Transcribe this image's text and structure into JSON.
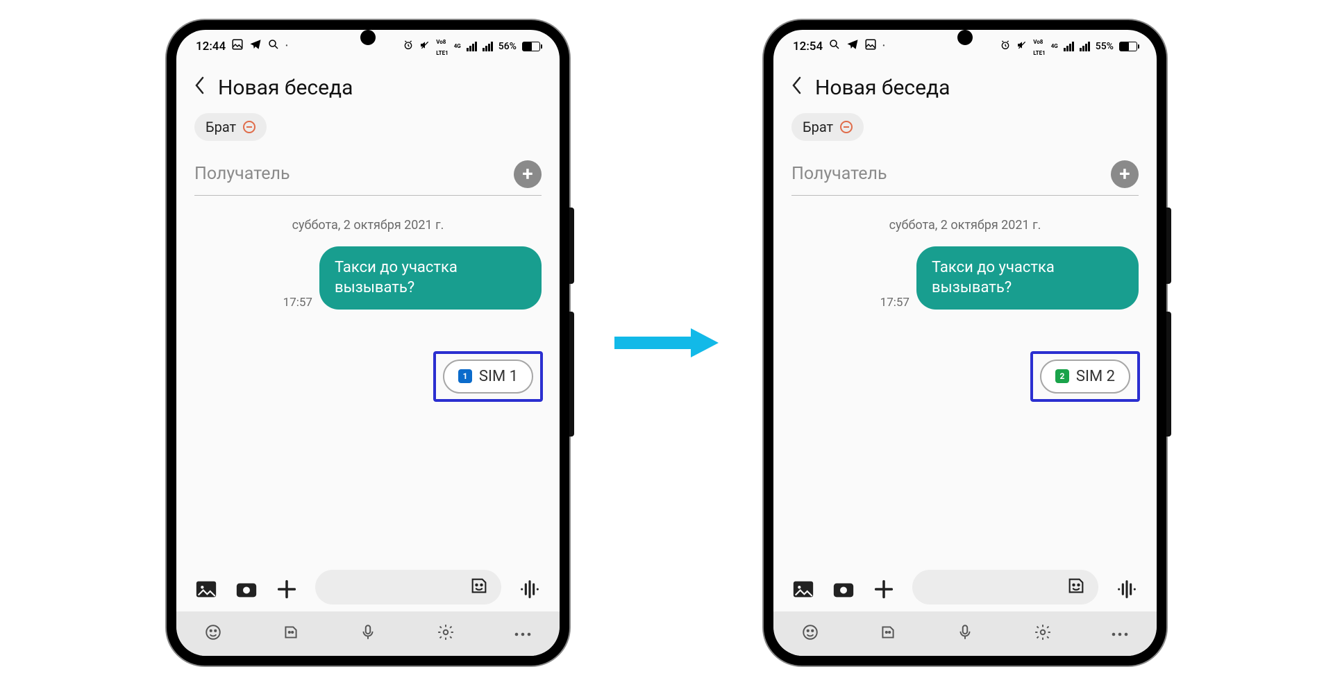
{
  "phones": [
    {
      "status": {
        "time": "12:44",
        "battery_pct": "56%",
        "battery_fill": 56
      },
      "header": {
        "title": "Новая беседа"
      },
      "chip": {
        "name": "Брат"
      },
      "recipient": {
        "placeholder": "Получатель"
      },
      "date": "суббота, 2 октября 2021 г.",
      "message": {
        "text": "Такси до участка вызывать?",
        "time": "17:57"
      },
      "sim": {
        "label": "SIM 1",
        "num": "1",
        "badge_class": "b1"
      }
    },
    {
      "status": {
        "time": "12:54",
        "battery_pct": "55%",
        "battery_fill": 55
      },
      "header": {
        "title": "Новая беседа"
      },
      "chip": {
        "name": "Брат"
      },
      "recipient": {
        "placeholder": "Получатель"
      },
      "date": "суббота, 2 октября 2021 г.",
      "message": {
        "text": "Такси до участка вызывать?",
        "time": "17:57"
      },
      "sim": {
        "label": "SIM 2",
        "num": "2",
        "badge_class": "b2"
      }
    }
  ],
  "status_icons": {
    "lte_top": "Vo8",
    "lte_bot": "LTE1",
    "net": "4G"
  }
}
